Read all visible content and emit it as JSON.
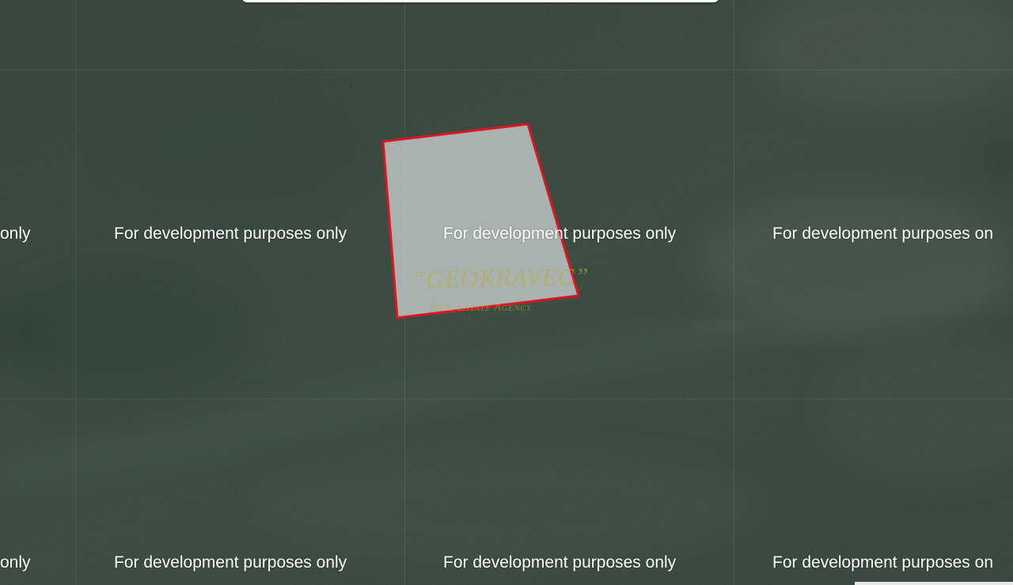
{
  "map": {
    "view": "satellite",
    "colors": {
      "parcel_fill": "#c8cfcf",
      "parcel_stroke": "#e0141e",
      "dev_text": "#ffffff",
      "watermark": "#bcaa3c"
    }
  },
  "dev_notice": {
    "text": "For development purposes only",
    "clipped_left": "only",
    "clipped_right": "For development purposes on"
  },
  "watermark": {
    "title": "“GEOKRAVEC”",
    "subtitle": "Real Estate Agency"
  }
}
